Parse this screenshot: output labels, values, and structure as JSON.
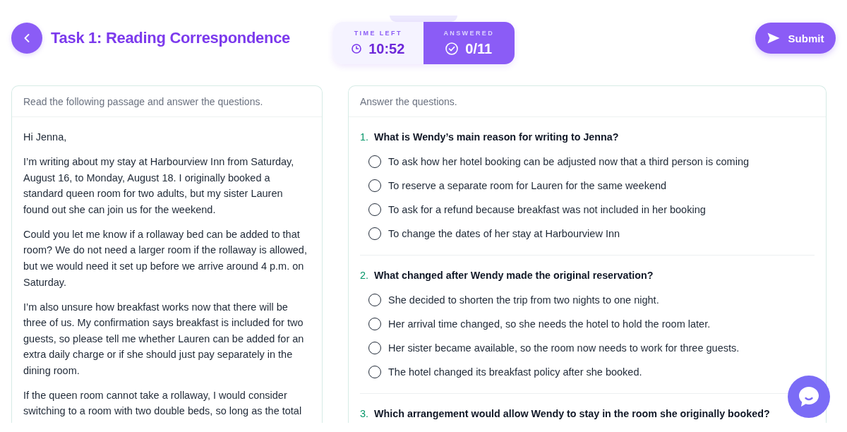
{
  "header": {
    "title": "Task 1: Reading Correspondence"
  },
  "status": [
    {
      "kind": "time",
      "label": "TIME LEFT",
      "value": "10:52"
    },
    {
      "kind": "answered",
      "label": "ANSWERED",
      "value": "0/11"
    }
  ],
  "submit": {
    "label": "Submit"
  },
  "passage": {
    "instruction": "Read the following passage and answer the questions.",
    "paragraphs": [
      "Hi Jenna,",
      "I’m writing about my stay at Harbourview Inn from Saturday, August 16, to Monday, August 18. I originally booked a standard queen room for two adults, but my sister Lauren found out she can join us for the weekend.",
      "Could you let me know if a rollaway bed can be added to that room? We do not need a larger room if the rollaway is allowed, but we would need it set up before we arrive around 4 p.m. on Saturday.",
      "I’m also unsure how breakfast works now that there will be three of us. My confirmation says breakfast is included for two guests, so please tell me whether Lauren can be added for an extra daily charge or if she should just pay separately in the dining room.",
      "If the queen room cannot take a rollaway, I would consider switching to a room with two double beds, so long as the total"
    ]
  },
  "questions": {
    "instruction": "Answer the questions.",
    "items": [
      {
        "number": "1.",
        "text": "What is Wendy’s main reason for writing to Jenna?",
        "options": [
          {
            "text": "To ask how her hotel booking can be adjusted now that a third person is coming",
            "selected": false
          },
          {
            "text": "To reserve a separate room for Lauren for the same weekend",
            "selected": false
          },
          {
            "text": "To ask for a refund because breakfast was not included in her booking",
            "selected": false
          },
          {
            "text": "To change the dates of her stay at Harbourview Inn",
            "selected": false
          }
        ]
      },
      {
        "number": "2.",
        "text": "What changed after Wendy made the original reservation?",
        "options": [
          {
            "text": "She decided to shorten the trip from two nights to one night.",
            "selected": false
          },
          {
            "text": "Her arrival time changed, so she needs the hotel to hold the room later.",
            "selected": false
          },
          {
            "text": "Her sister became available, so the room now needs to work for three guests.",
            "selected": false
          },
          {
            "text": "The hotel changed its breakfast policy after she booked.",
            "selected": false
          }
        ]
      },
      {
        "number": "3.",
        "text": "Which arrangement would allow Wendy to stay in the room she originally booked?"
      }
    ]
  }
}
